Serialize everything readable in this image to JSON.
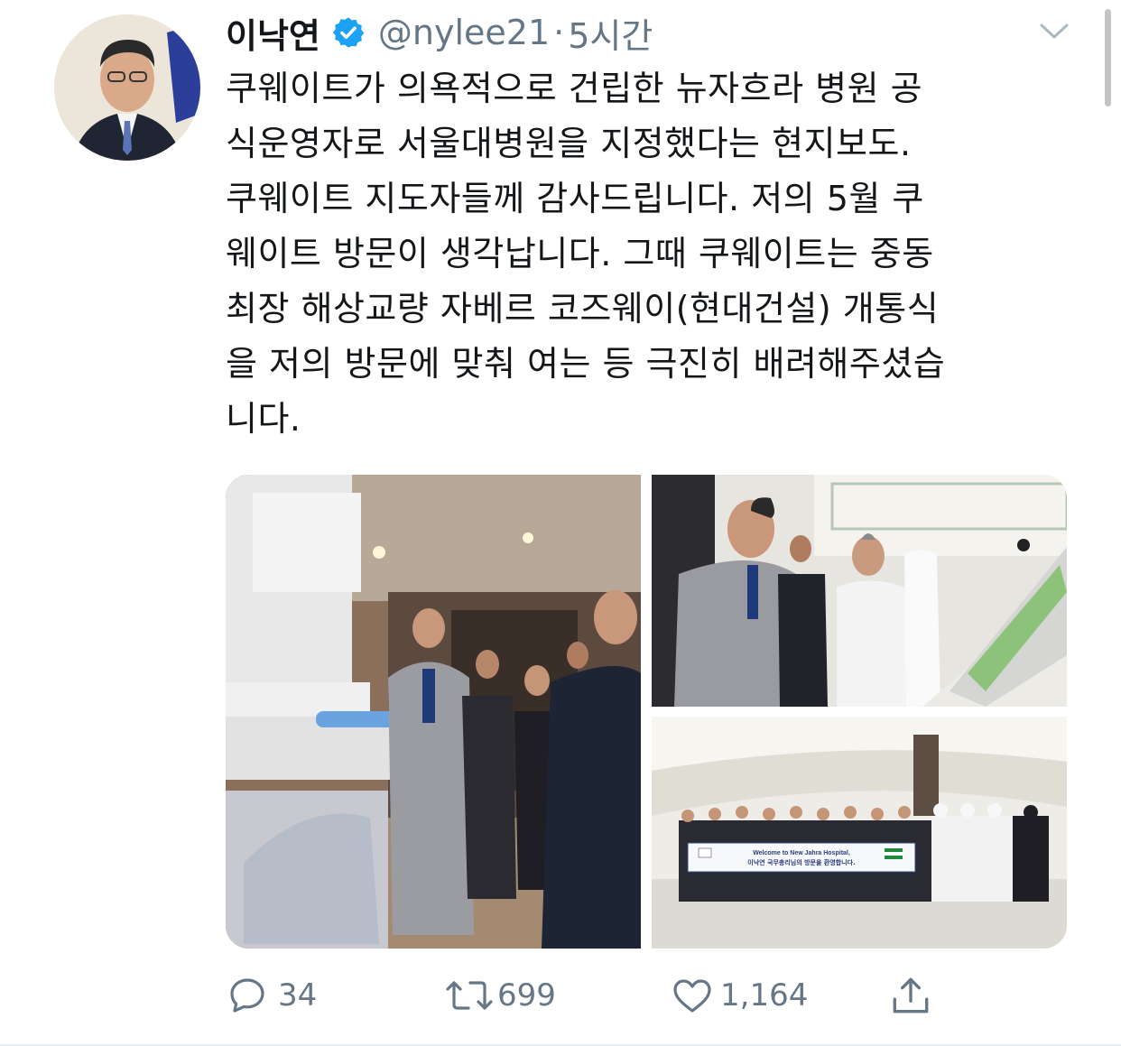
{
  "tweet": {
    "author": {
      "display_name": "이낙연",
      "handle": "@nylee21",
      "verified": true,
      "avatar_icon": "profile-photo"
    },
    "separator": "·",
    "time": "5시간",
    "text": "쿠웨이트가 의욕적으로 건립한 뉴자흐라 병원 공\n식운영자로 서울대병원을 지정했다는 현지보도.\n쿠웨이트 지도자들께 감사드립니다. 저의 5월 쿠\n웨이트 방문이 생각납니다. 그때 쿠웨이트는 중동\n최장 해상교량 자베르 코즈웨이(현대건설) 개통식\n을 저의 방문에 맞춰 여는 등 극진히 배려해주셨습\n니다.",
    "media": {
      "banner_line1": "Welcome to New Jahra Hospital,",
      "banner_line2": "이낙연 국무총리님의 방문을 환영합니다."
    },
    "actions": {
      "reply_count": "34",
      "retweet_count": "699",
      "like_count": "1,164"
    }
  },
  "colors": {
    "text": "#14171a",
    "secondary": "#657786",
    "verified": "#1da1f2"
  },
  "icons": [
    "verified-badge-icon",
    "chevron-down-icon",
    "reply-icon",
    "retweet-icon",
    "like-icon",
    "share-icon"
  ]
}
